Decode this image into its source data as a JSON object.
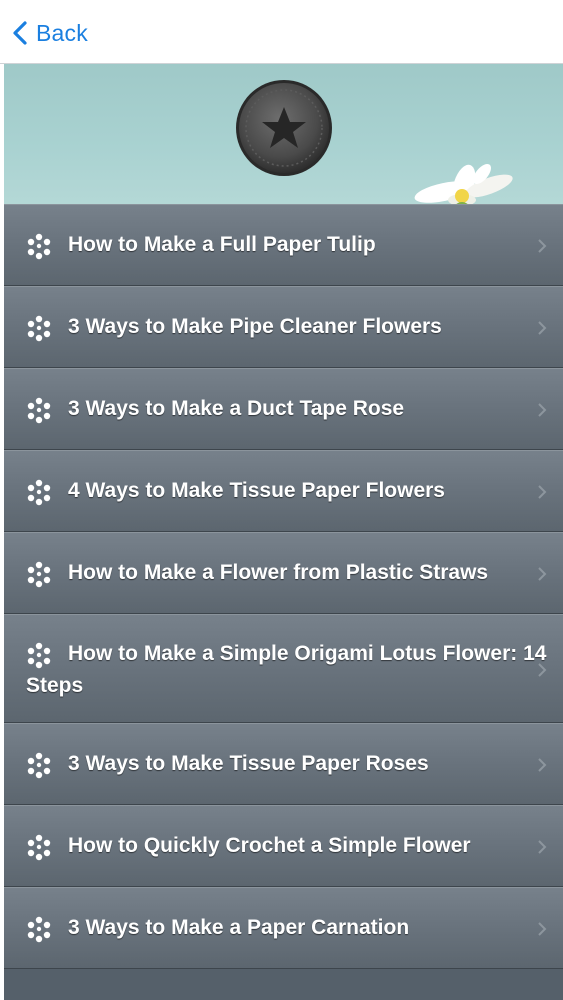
{
  "nav": {
    "back_label": "Back",
    "back_icon": "chevron-left-icon",
    "accent_color": "#1a7fe0"
  },
  "banner": {
    "badge_icon": "star-icon",
    "background_color": "#a9d2d1"
  },
  "list": {
    "item_icon": "dots-cluster-icon",
    "chevron_icon": "chevron-right-icon",
    "items": [
      {
        "title": "How to Make a Full Paper Tulip"
      },
      {
        "title": "3 Ways to Make Pipe Cleaner Flowers"
      },
      {
        "title": "3 Ways to Make a Duct Tape Rose"
      },
      {
        "title": "4 Ways to Make Tissue Paper Flowers"
      },
      {
        "title": "How to Make a Flower from Plastic Straws"
      },
      {
        "title": "How to Make a Simple Origami Lotus Flower: 14 Steps"
      },
      {
        "title": "3 Ways to Make Tissue Paper Roses"
      },
      {
        "title": "How to Quickly Crochet a Simple Flower"
      },
      {
        "title": "3 Ways to Make a Paper Carnation"
      }
    ]
  }
}
